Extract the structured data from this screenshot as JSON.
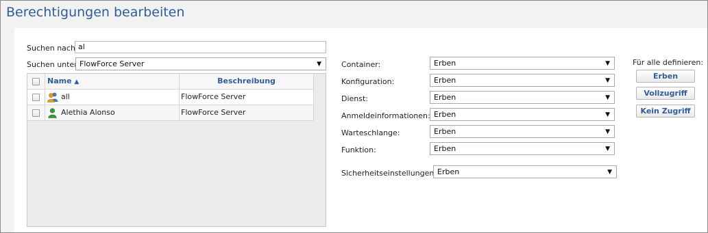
{
  "title": "Berechtigungen bearbeiten",
  "search": {
    "label": "Suchen nach:",
    "value": "al"
  },
  "search_in": {
    "label": "Suchen unter:",
    "value": "FlowForce Server"
  },
  "grid": {
    "columns": {
      "name": "Name",
      "description": "Beschreibung"
    },
    "rows": [
      {
        "name": "all",
        "description": "FlowForce Server",
        "icon": "user-group-icon"
      },
      {
        "name": "Alethia Alonso",
        "description": "FlowForce Server",
        "icon": "user-icon"
      }
    ]
  },
  "permissions": [
    {
      "label": "Container:",
      "value": "Erben"
    },
    {
      "label": "Konfiguration:",
      "value": "Erben"
    },
    {
      "label": "Dienst:",
      "value": "Erben"
    },
    {
      "label": "Anmeldeinformationen:",
      "value": "Erben"
    },
    {
      "label": "Warteschlange:",
      "value": "Erben"
    },
    {
      "label": "Funktion:",
      "value": "Erben"
    }
  ],
  "security": {
    "label": "Sicherheitseinstellungen:",
    "value": "Erben"
  },
  "set_all": {
    "label": "Für alle definieren:",
    "buttons": [
      "Erben",
      "Vollzugriff",
      "Kein Zugriff"
    ]
  },
  "colors": {
    "accent": "#2e5d9a",
    "user_green": "#3a9a3a",
    "group_orange": "#e39b2b"
  }
}
